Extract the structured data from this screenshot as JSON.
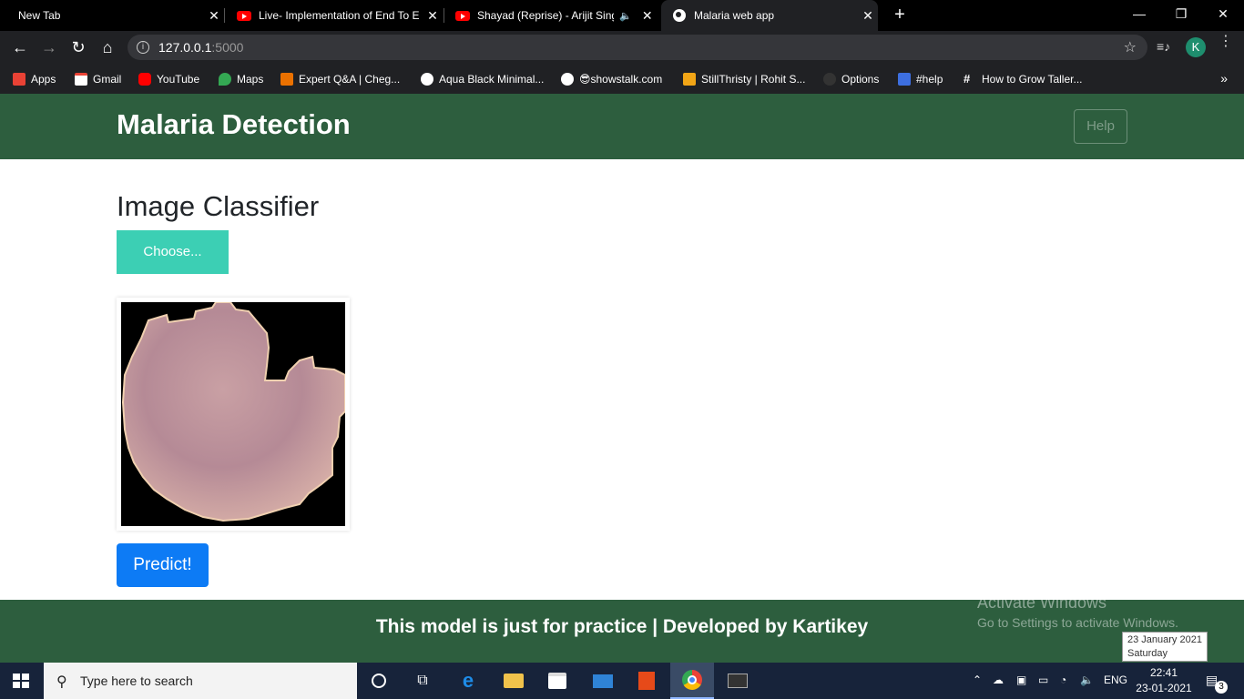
{
  "browser": {
    "tabs": [
      {
        "title": "New Tab",
        "favicon": "none"
      },
      {
        "title": "Live- Implementation of End To E",
        "favicon": "youtube-icon"
      },
      {
        "title": "Shayad (Reprise) - Arijit Singh",
        "favicon": "youtube-icon"
      },
      {
        "title": "Malaria web app",
        "favicon": "globe-icon"
      }
    ],
    "new_tab": "+",
    "window_controls": {
      "minimize": "—",
      "restore": "❐",
      "close": "✕"
    },
    "url_host": "127.0.0.1",
    "url_port": ":5000",
    "profile_initial": "K",
    "bookmarks": [
      {
        "label": "Apps",
        "icon": "apps-grid-icon",
        "color": "#e94235"
      },
      {
        "label": "Gmail",
        "icon": "gmail-icon",
        "color": "#ea4335"
      },
      {
        "label": "YouTube",
        "icon": "youtube-icon",
        "color": "#ff0000"
      },
      {
        "label": "Maps",
        "icon": "maps-pin-icon",
        "color": "#34a853"
      },
      {
        "label": "Expert Q&A | Cheg...",
        "icon": "chegg-icon",
        "color": "#eb7100"
      },
      {
        "label": "Aqua Black Minimal...",
        "icon": "globe-icon",
        "color": "#ffffff"
      },
      {
        "label": "😎showstalk.com",
        "icon": "globe-icon",
        "color": "#ffffff"
      },
      {
        "label": "StillThristy | Rohit S...",
        "icon": "mug-icon",
        "color": "#f2a516"
      },
      {
        "label": "Options",
        "icon": "github-icon",
        "color": "#333333"
      },
      {
        "label": "#help",
        "icon": "help-app-icon",
        "color": "#3d6fe0"
      },
      {
        "label": "How to Grow Taller...",
        "icon": "hash-icon",
        "color": "#ffffff"
      }
    ]
  },
  "page": {
    "brand": "Malaria Detection",
    "help_label": "Help",
    "heading": "Image Classifier",
    "choose_label": "Choose...",
    "predict_label": "Predict!",
    "footer": "This model is just for practice | Developed by Kartikey",
    "colors": {
      "navbar": "#2d5e3e",
      "choose": "#3ccfb4",
      "predict": "#0d7bf5"
    }
  },
  "os": {
    "watermark_title": "Activate Windows",
    "watermark_sub": "Go to Settings to activate Windows.",
    "tooltip_date": "23 January 2021",
    "tooltip_day": "Saturday",
    "search_placeholder": "Type here to search",
    "language": "ENG",
    "time": "22:41",
    "date": "23-01-2021",
    "notifications": "3"
  }
}
